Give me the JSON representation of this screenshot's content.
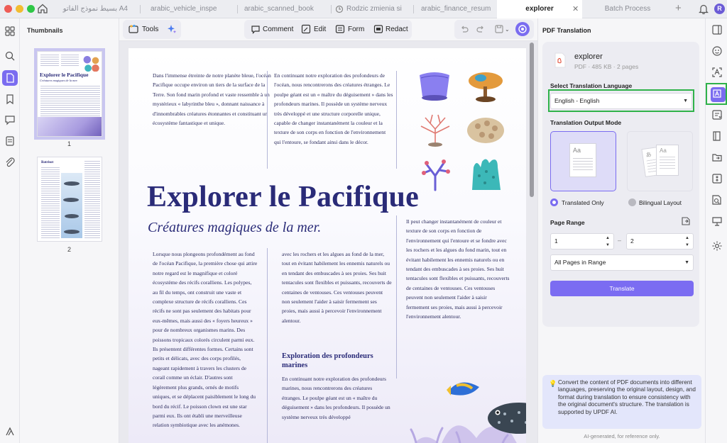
{
  "tabs": [
    {
      "label": "A4 بسيط نموذج الفاتورة",
      "active": false
    },
    {
      "label": "arabic_vehicle_inspe",
      "active": false
    },
    {
      "label": "arabic_scanned_book",
      "active": false
    },
    {
      "label": "Rodzic zmienia si",
      "active": false
    },
    {
      "label": "arabic_finance_resum",
      "active": false
    },
    {
      "label": "explorer",
      "active": true
    },
    {
      "label": "Batch Process",
      "active": false
    }
  ],
  "avatar_initial": "R",
  "left_rail": {
    "icons": [
      "grid-icon",
      "search-icon",
      "document-icon",
      "bookmark-icon",
      "comment-icon",
      "layers-icon",
      "attachment-icon"
    ],
    "active": "document-icon",
    "bottom_icon": "updf-logo-icon"
  },
  "thumbnails": {
    "title": "Thumbnails",
    "pages": [
      {
        "number": "1",
        "mini_title": "Explorer le Pacifique",
        "mini_subtitle": "Créatures magiques de la mer."
      },
      {
        "number": "2",
        "mini_title": "Batrisot"
      }
    ]
  },
  "toolbar": {
    "tools": "Tools",
    "comment": "Comment",
    "edit": "Edit",
    "form": "Form",
    "redact": "Redact"
  },
  "document": {
    "col1_top": "Dans l'immense étreinte de notre planète bleue, l'océan Pacifique occupe environ un tiers de la surface de la Terre. Son fond marin profond et vaste ressemble à un mystérieux « labyrinthe bleu », donnant naissance à d'innombrables créatures étonnantes et constituant un écosystème fantastique et unique.",
    "col2_top": "En continuant notre exploration des profondeurs de l'océan, nous rencontrerons des créatures étranges. Le poulpe géant est un « maître du déguisement » dans les profondeurs marines. Il possède un système nerveux très développé et une structure corporelle unique, capable de changer instantanément la couleur et la texture de son corps en fonction de l'environnement qui l'entoure, se fondant ainsi dans le décor.",
    "title": "Explorer le Pacifique",
    "subtitle": "Créatures magiques de la mer.",
    "col3_right": "Il peut changer instantanément de couleur et texture de son corps en fonction de l'environnement qui l'entoure et se fondre avec les rochers et les algues du fond marin, tout en évitant habilement les ennemis naturels ou en tendant des embuscades à ses proies. Ses huit tentacules sont flexibles et puissants, recouverts de centaines de ventouses. Ces ventouses peuvent non seulement l'aider à saisir fermement ses proies, mais aussi à percevoir l'environnement alentour.",
    "col1_bottom": "Lorsque nous plongeons profondément au fond de l'océan Pacifique, la première chose qui attire notre regard est le magnifique et coloré écosystème des récifs coralliens. Les polypes, au fil du temps, ont construit une vaste et complexe structure de récifs coralliens. Ces récifs ne sont pas seulement des habitats pour eux-mêmes, mais aussi des « foyers heureux » pour de nombreux organismes marins. Des poissons tropicaux colorés circulent parmi eux. Ils présentent différentes formes. Certains sont petits et délicats, avec des corps profilés, nageant rapidement à travers les clusters de corail comme un éclair. D'autres sont légèrement plus grands, ornés de motifs uniques, et se déplacent paisiblement le long du bord du récif. Le poisson clown est une star parmi eux. Ils ont établi une merveilleuse relation symbiotique avec les anémones.",
    "col2_bottom": "avec les rochers et les algues au fond de la mer, tout en évitant habilement les ennemis naturels ou en tendant des embuscades à ses proies. Ses huit tentacules sont flexibles et puissants, recouverts de centaines de ventouses. Ces ventouses peuvent non seulement l'aider à saisir fermement ses proies, mais aussi à percevoir l'environnement alentour.",
    "section_heading": "Exploration des profondeurs marines",
    "section_body": "En continuant notre exploration des profondeurs marines, nous rencontrerons des créatures étranges. Le poulpe géant est un « maître du déguisement » dans les profondeurs. Il possède un système nerveux très développé"
  },
  "panel": {
    "title": "PDF Translation",
    "file_name": "explorer",
    "file_meta": "PDF · 485 KB · 2 pages",
    "language_label": "Select Translation Language",
    "language_value": "English - English",
    "output_mode_label": "Translation Output Mode",
    "mode_translated": "Translated Only",
    "mode_bilingual": "Bilingual Layout",
    "selected_mode": "Translated Only",
    "page_range_label": "Page Range",
    "range_from": "1",
    "range_to": "2",
    "range_dash": "–",
    "range_option": "All Pages in Range",
    "translate_button": "Translate",
    "tip": "Convert the content of PDF documents into different languages, preserving the original layout, design, and format during translation to ensure consistency with the original document's structure. The translation is supported by UPDF AI.",
    "ai_note": "AI-generated, for reference only.",
    "mode_icon_text": "Aa"
  },
  "right_rail": {
    "icons": [
      "ai-assistant-icon",
      "ocr-icon",
      "translate-icon",
      "smart-form-icon",
      "book-icon",
      "folder-convert-icon",
      "compress-icon",
      "document-search-icon",
      "presentation-icon",
      "settings-icon"
    ],
    "active": "translate-icon"
  },
  "colors": {
    "accent": "#7a6cf0",
    "highlight": "#2fb24a",
    "title_navy": "#2a2b78"
  }
}
